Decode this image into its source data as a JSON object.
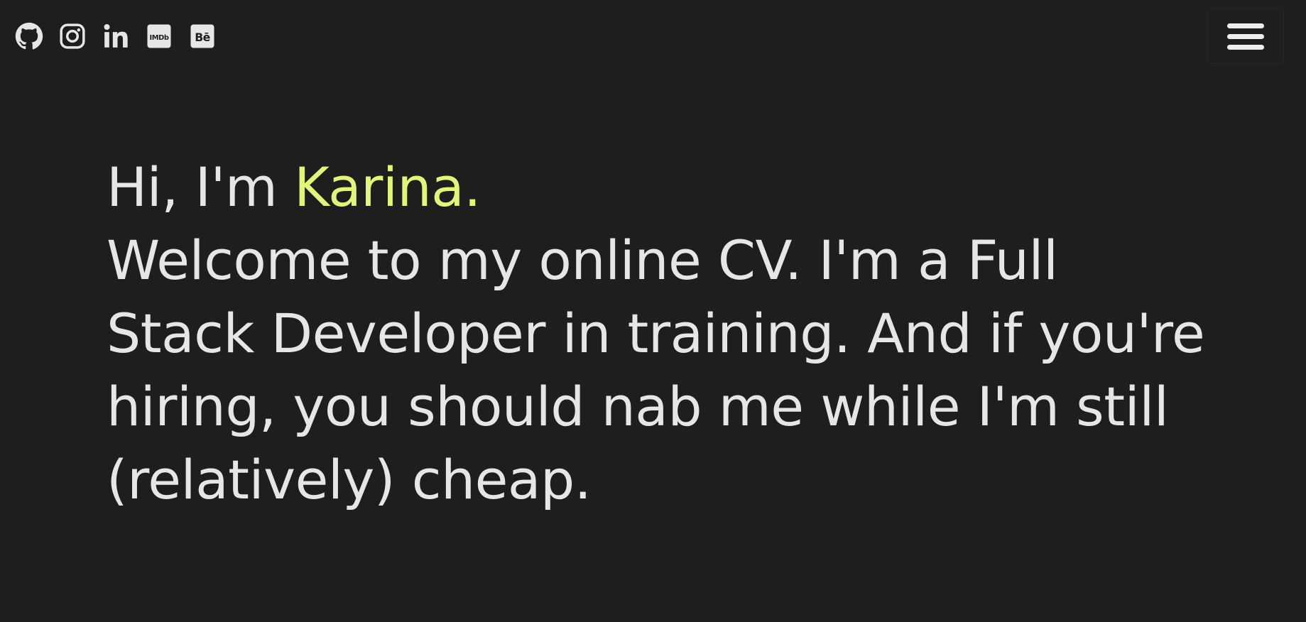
{
  "social_links": [
    {
      "name": "GitHub",
      "icon": "github-icon"
    },
    {
      "name": "Instagram",
      "icon": "instagram-icon"
    },
    {
      "name": "LinkedIn",
      "icon": "linkedin-icon",
      "glyph": "in"
    },
    {
      "name": "IMDb",
      "icon": "imdb-icon",
      "glyph": "IMDb"
    },
    {
      "name": "Behance",
      "icon": "behance-icon",
      "glyph": "Bē"
    }
  ],
  "menu": {
    "icon": "hamburger-menu-icon"
  },
  "hero": {
    "greeting_prefix": "Hi, I'm ",
    "name": "Karina.",
    "lines": [
      "Welcome to my online CV. I'm a Full",
      "Stack Developer in training. And if you're",
      "hiring, you should nab me while I'm still",
      "(relatively) cheap."
    ]
  },
  "colors": {
    "background": "#1e1e1e",
    "text": "#e6e6e6",
    "accent": "#e2f57a"
  }
}
